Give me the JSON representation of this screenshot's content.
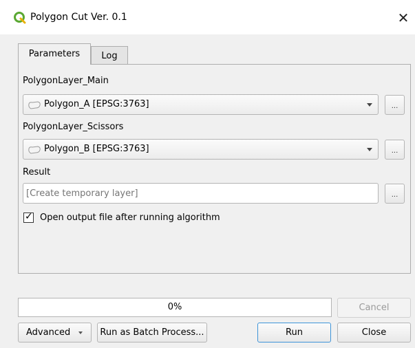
{
  "window": {
    "title": "Polygon Cut Ver. 0.1",
    "logo_icon": "qgis-logo-icon",
    "close_icon": "close-icon",
    "close_glyph": "✕"
  },
  "tabs": [
    {
      "label": "Parameters",
      "active": true
    },
    {
      "label": "Log",
      "active": false
    }
  ],
  "params": {
    "main_layer": {
      "label": "PolygonLayer_Main",
      "value": "Polygon_A [EPSG:3763]",
      "icon": "polygon-layer-icon"
    },
    "scissors_layer": {
      "label": "PolygonLayer_Scissors",
      "value": "Polygon_B [EPSG:3763]",
      "icon": "polygon-layer-icon"
    },
    "result": {
      "label": "Result",
      "placeholder": "[Create temporary layer]",
      "value": ""
    },
    "ellipsis_label": "...",
    "open_output": {
      "label": "Open output file after running algorithm",
      "checked": true,
      "check_glyph": "✓"
    }
  },
  "progress": {
    "value": 0,
    "text": "0%"
  },
  "buttons": {
    "cancel": "Cancel",
    "advanced": "Advanced",
    "batch": "Run as Batch Process...",
    "run": "Run",
    "close": "Close"
  },
  "colors": {
    "accent": "#3c93d8",
    "progress_fill": "#3daee9",
    "qgis_green": "#4caf50"
  }
}
